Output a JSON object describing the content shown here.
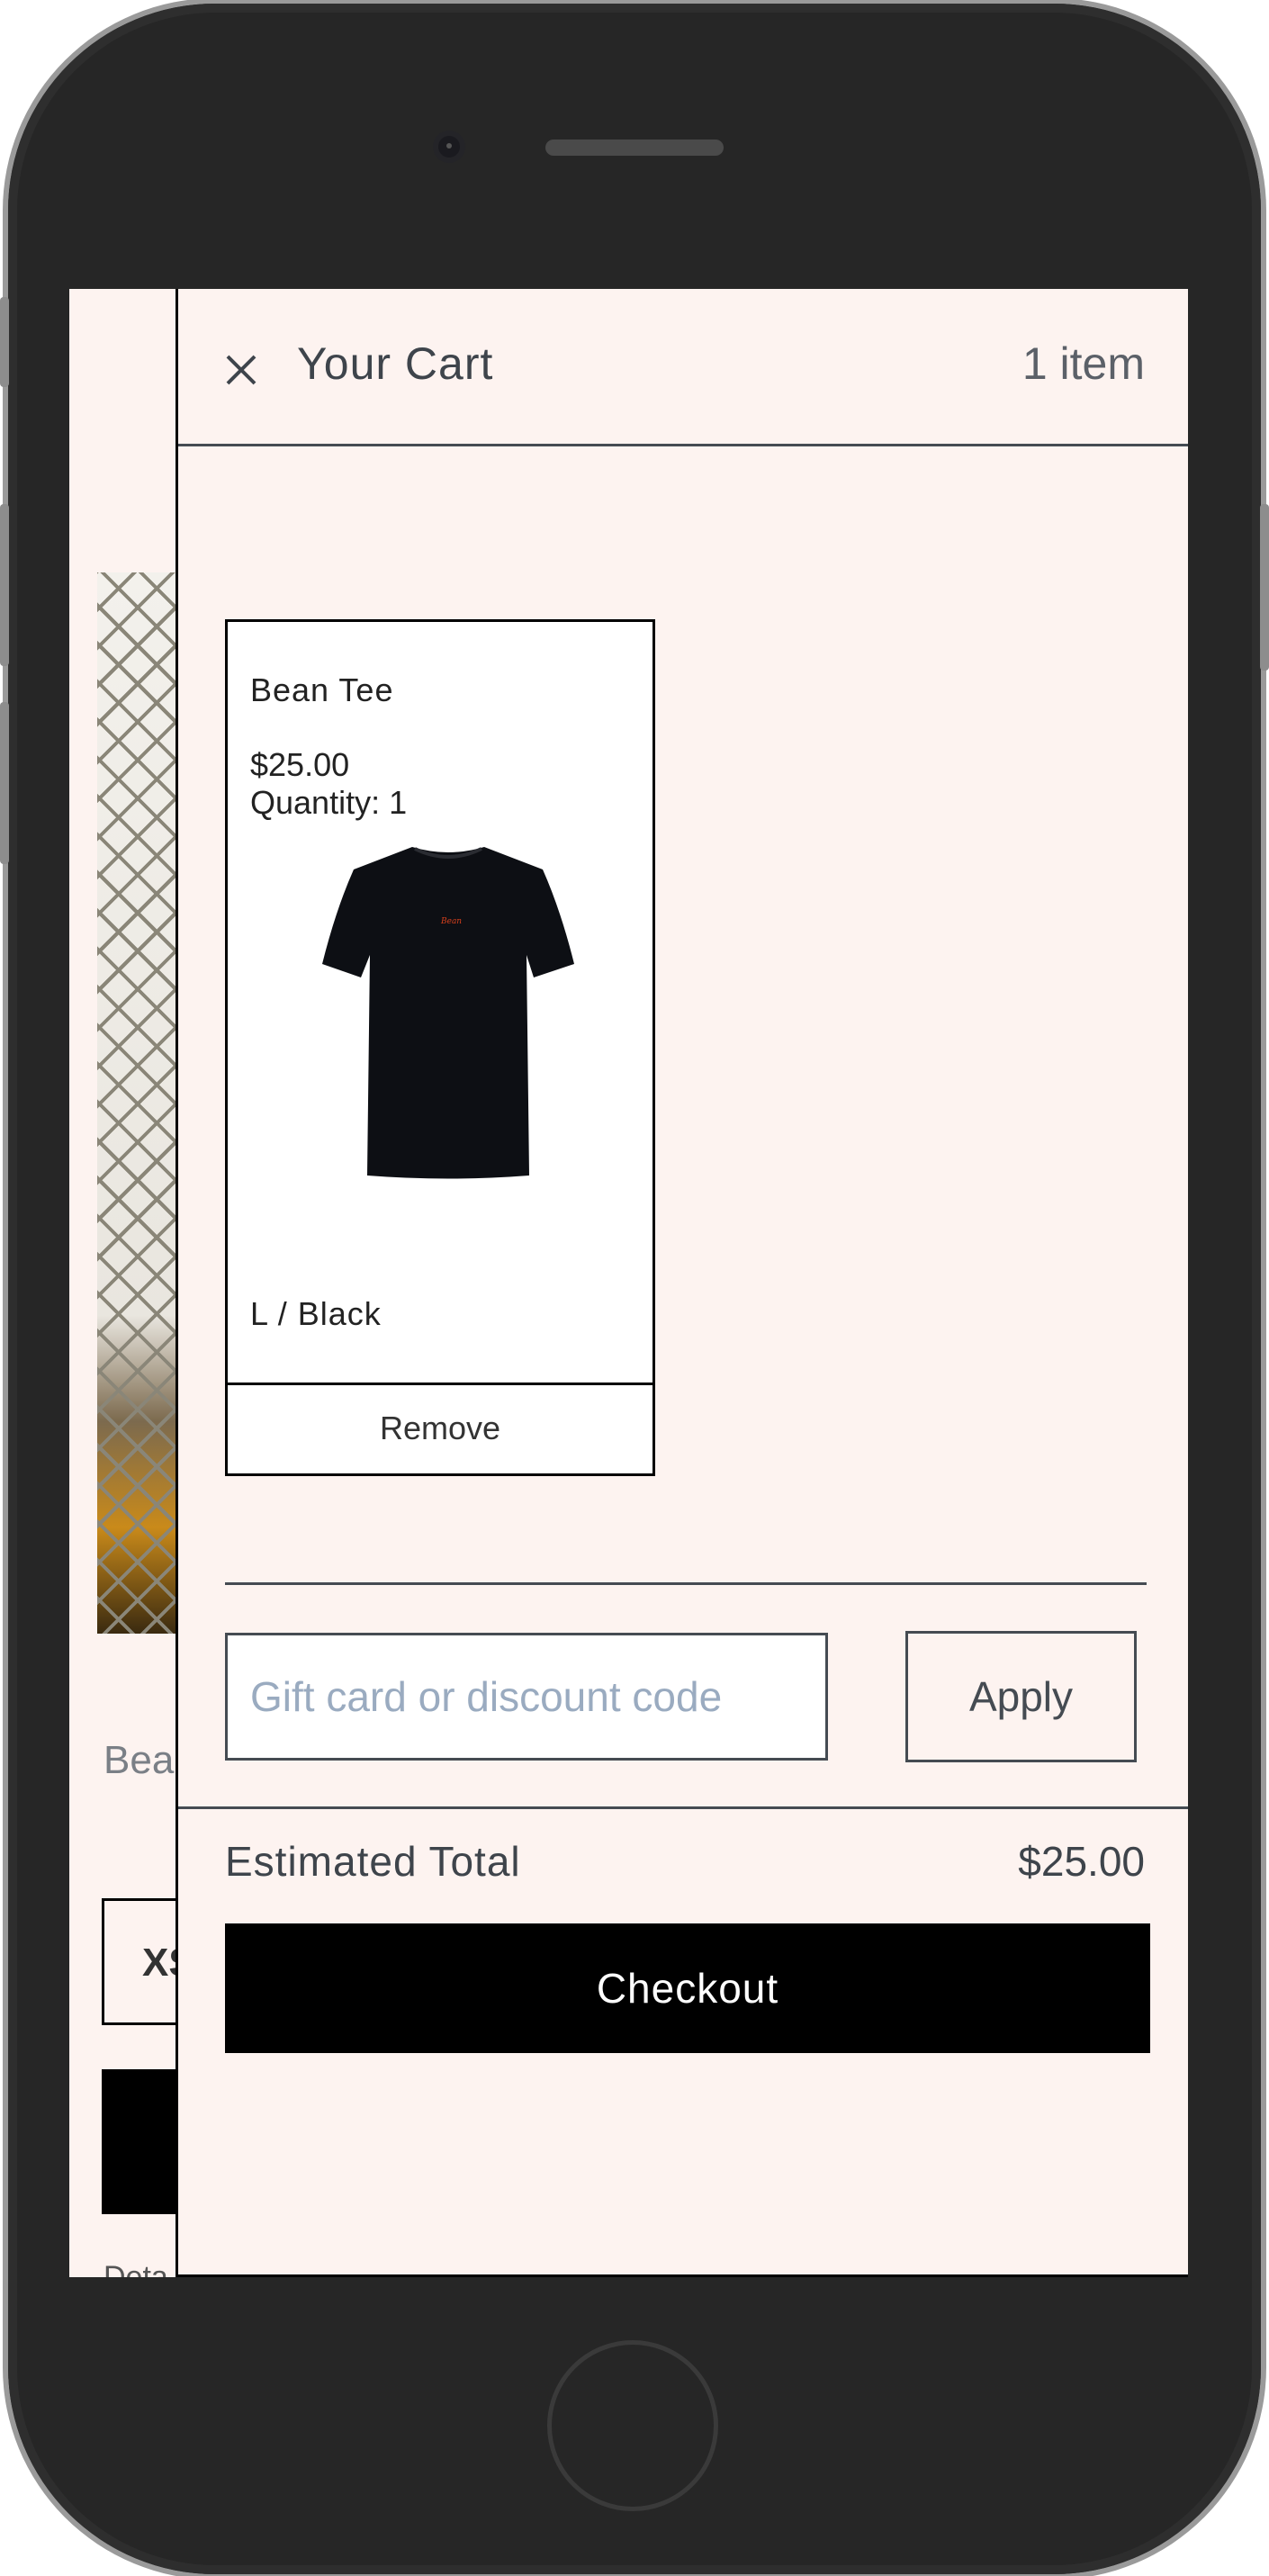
{
  "background_page": {
    "product_title_partial": "Bea",
    "size_option_partial": "XS",
    "details_partial": "Deta"
  },
  "cart": {
    "title": "Your Cart",
    "item_count": "1 item",
    "close_icon": "close-icon",
    "items": [
      {
        "name": "Bean Tee",
        "price": "$25.00",
        "quantity": "Quantity: 1",
        "variant": "L / Black",
        "remove_label": "Remove",
        "image": "black-t-shirt"
      }
    ],
    "discount": {
      "placeholder": "Gift card or discount code",
      "value": "",
      "apply_label": "Apply"
    },
    "total": {
      "label": "Estimated Total",
      "value": "$25.00"
    },
    "checkout_label": "Checkout"
  },
  "colors": {
    "panel_bg": "#fdf3f0",
    "text": "#3e444b",
    "checkout_bg": "#000000",
    "placeholder": "#9aabc0"
  }
}
